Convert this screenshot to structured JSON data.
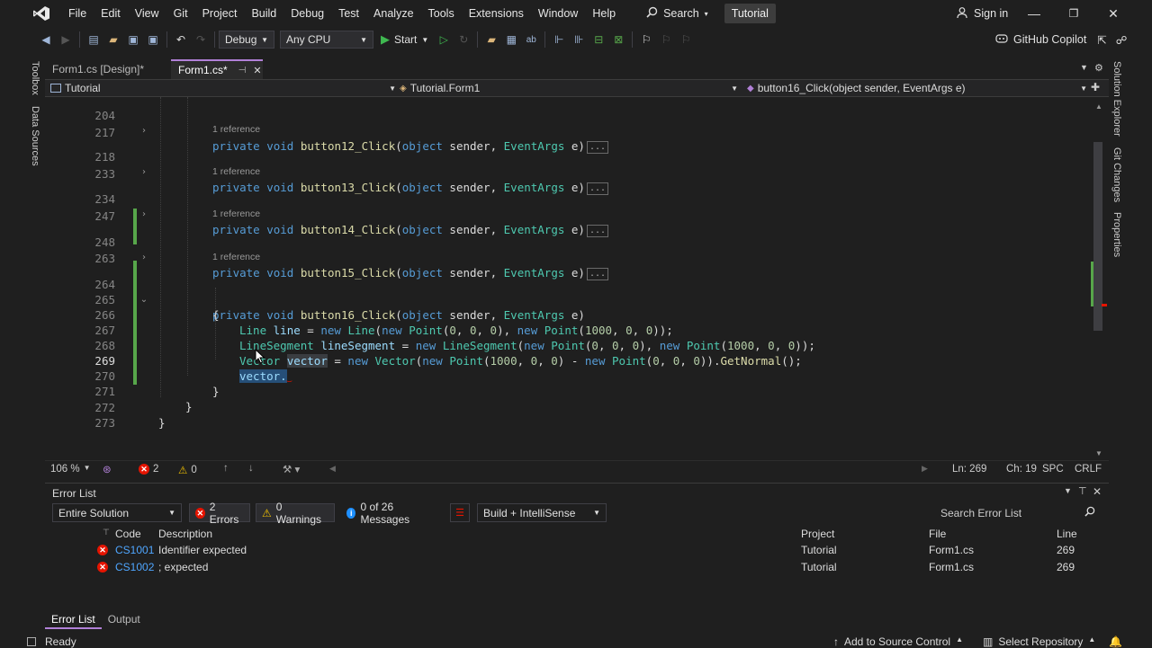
{
  "menu": {
    "items": [
      "File",
      "Edit",
      "View",
      "Git",
      "Project",
      "Build",
      "Debug",
      "Test",
      "Analyze",
      "Tools",
      "Extensions",
      "Window",
      "Help"
    ],
    "search_label": "Search",
    "solution_name": "Tutorial",
    "signin_label": "Sign in"
  },
  "toolbar": {
    "config": "Debug",
    "platform": "Any CPU",
    "start_label": "Start",
    "copilot_label": "GitHub Copilot"
  },
  "left_strip": {
    "toolbox": "Toolbox",
    "data_sources": "Data Sources"
  },
  "right_strip": {
    "solution_explorer": "Solution Explorer",
    "git_changes": "Git Changes",
    "properties": "Properties"
  },
  "tabs": [
    {
      "label": "Form1.cs [Design]*",
      "active": false
    },
    {
      "label": "Form1.cs*",
      "active": true
    }
  ],
  "navbar": {
    "project": "Tutorial",
    "class": "Tutorial.Form1",
    "member": "button16_Click(object sender, EventArgs e)"
  },
  "editor": {
    "ref_text": "1 reference",
    "lines": [
      "204",
      "217",
      "218",
      "233",
      "234",
      "247",
      "248",
      "263",
      "264",
      "265",
      "266",
      "267",
      "268",
      "269",
      "270",
      "271",
      "272",
      "273"
    ],
    "methods": [
      "button12_Click",
      "button13_Click",
      "button14_Click",
      "button15_Click",
      "button16_Click"
    ]
  },
  "status": {
    "zoom": "106 %",
    "errors": "2",
    "warnings": "0",
    "ln": "Ln: 269",
    "ch": "Ch: 19",
    "spc": "SPC",
    "crlf": "CRLF"
  },
  "error_list": {
    "title": "Error List",
    "scope": "Entire Solution",
    "errors_btn": "2 Errors",
    "warnings_btn": "0 Warnings",
    "messages_btn": "0 of 26 Messages",
    "build_filter": "Build + IntelliSense",
    "search_placeholder": "Search Error List",
    "columns": {
      "code": "Code",
      "description": "Description",
      "project": "Project",
      "file": "File",
      "line": "Line"
    },
    "rows": [
      {
        "code": "CS1001",
        "description": "Identifier expected",
        "project": "Tutorial",
        "file": "Form1.cs",
        "line": "269"
      },
      {
        "code": "CS1002",
        "description": "; expected",
        "project": "Tutorial",
        "file": "Form1.cs",
        "line": "269"
      }
    ],
    "tab_error_list": "Error List",
    "tab_output": "Output"
  },
  "statusbar": {
    "ready": "Ready",
    "add_source": "Add to Source Control",
    "select_repo": "Select Repository"
  }
}
